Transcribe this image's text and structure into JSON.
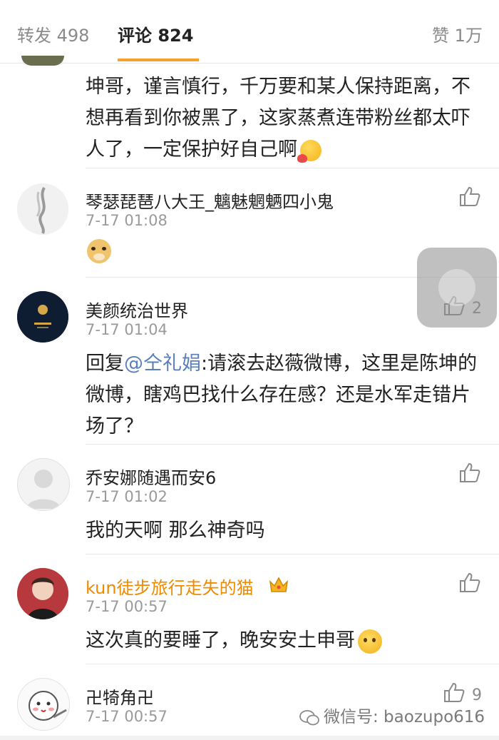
{
  "tabs": {
    "repost": "转发 498",
    "comments": "评论 824",
    "likes": "赞 1万"
  },
  "comments": [
    {
      "text": "坤哥，谨言慎行，千万要和某人保持距离，不想再看到你被黑了，这家蒸煮连带粉丝都太吓人了，一定保护好自己啊",
      "emoji": "kiss-face-emoji"
    },
    {
      "username": "琴瑟琵琶八大王_魑魅魍魉四小鬼",
      "time": "7-17 01:08",
      "emoji": "doge-emoji",
      "likes": ""
    },
    {
      "username": "美颜统治世界",
      "time": "7-17 01:04",
      "reply_prefix": "回复",
      "mention": "@仝礼娟",
      "text": ":请滚去赵薇微博，这里是陈坤的微博，瞎鸡巴找什么存在感？还是水军走错片场了？",
      "likes": "2"
    },
    {
      "username": "乔安娜随遇而安6",
      "time": "7-17 01:02",
      "text": "我的天啊  那么神奇吗",
      "likes": ""
    },
    {
      "username": "kun徒步旅行走失的猫",
      "time": "7-17 00:57",
      "text": "这次真的要睡了，晚安安土申哥",
      "emoji": "shy-face-emoji",
      "badge": "crown-badge",
      "likes": ""
    },
    {
      "username": "卍犄角卍",
      "time": "7-17 00:57",
      "likes": "9"
    }
  ],
  "watermark": "微信号: baozupo616",
  "colors": {
    "tab_accent": "#f7a12b",
    "mention": "#5a7fbd",
    "vip_name": "#f08a00"
  }
}
